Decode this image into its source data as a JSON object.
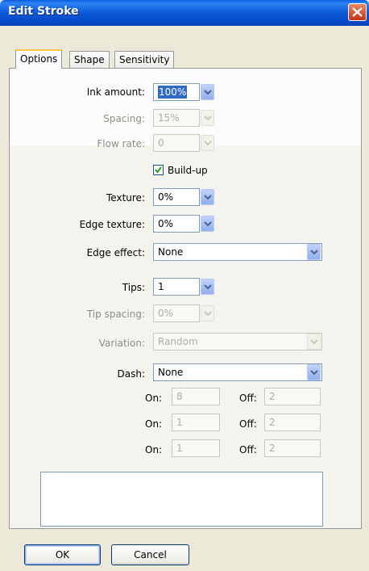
{
  "window": {
    "title": "Edit Stroke"
  },
  "tabs": [
    {
      "label": "Options"
    },
    {
      "label": "Shape"
    },
    {
      "label": "Sensitivity"
    }
  ],
  "options": {
    "ink_amount": {
      "label": "Ink amount:",
      "value": "100%"
    },
    "spacing": {
      "label": "Spacing:",
      "value": "15%"
    },
    "flow_rate": {
      "label": "Flow rate:",
      "value": "0"
    },
    "build_up": {
      "label": "Build-up",
      "checked": true
    },
    "texture": {
      "label": "Texture:",
      "value": "0%"
    },
    "edge_texture": {
      "label": "Edge texture:",
      "value": "0%"
    },
    "edge_effect": {
      "label": "Edge effect:",
      "value": "None"
    },
    "tips": {
      "label": "Tips:",
      "value": "1"
    },
    "tip_spacing": {
      "label": "Tip spacing:",
      "value": "0%"
    },
    "variation": {
      "label": "Variation:",
      "value": "Random"
    },
    "dash": {
      "label": "Dash:",
      "value": "None"
    },
    "dash_rows": [
      {
        "on_label": "On:",
        "on_value": "8",
        "off_label": "Off:",
        "off_value": "2"
      },
      {
        "on_label": "On:",
        "on_value": "1",
        "off_label": "Off:",
        "off_value": "2"
      },
      {
        "on_label": "On:",
        "on_value": "1",
        "off_label": "Off:",
        "off_value": "2"
      }
    ]
  },
  "buttons": {
    "ok": "OK",
    "cancel": "Cancel"
  }
}
